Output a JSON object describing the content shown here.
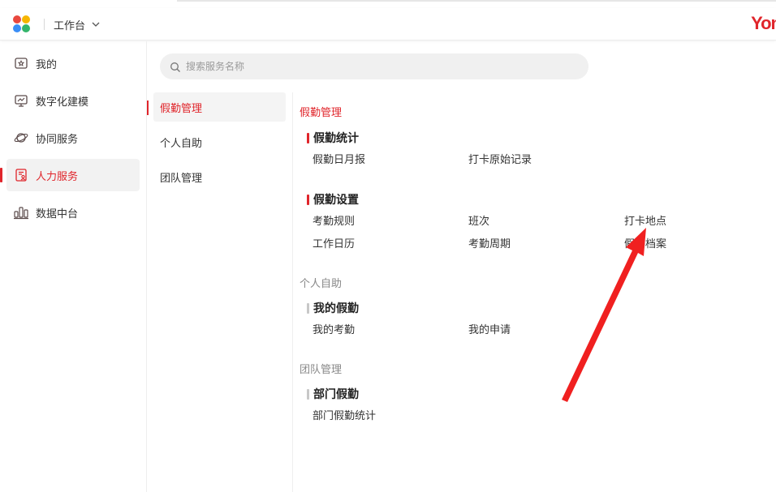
{
  "header": {
    "workbench_label": "工作台",
    "brand_text": "Yon",
    "brand_color": "#e0252b",
    "logo_colors": [
      "#e9483f",
      "#f6b500",
      "#3a8ef6",
      "#34b56b"
    ]
  },
  "search": {
    "placeholder": "搜索服务名称"
  },
  "leftnav": {
    "items": [
      {
        "label": "我的",
        "icon": "star-folder-icon",
        "active": false
      },
      {
        "label": "数字化建模",
        "icon": "monitor-chart-icon",
        "active": false
      },
      {
        "label": "协同服务",
        "icon": "planet-icon",
        "active": false
      },
      {
        "label": "人力服务",
        "icon": "id-card-icon",
        "active": true
      },
      {
        "label": "数据中台",
        "icon": "bar-chart-icon",
        "active": false
      }
    ]
  },
  "categories": [
    {
      "label": "假勤管理",
      "active": true
    },
    {
      "label": "个人自助",
      "active": false
    },
    {
      "label": "团队管理",
      "active": false
    }
  ],
  "sections": {
    "attendance": {
      "title": "假勤管理",
      "group1": {
        "title": "假勤统计",
        "links": [
          "假勤日月报",
          "打卡原始记录"
        ]
      },
      "group2": {
        "title": "假勤设置",
        "links": [
          "考勤规则",
          "班次",
          "打卡地点",
          "工作日历",
          "考勤周期",
          "假勤档案"
        ]
      }
    },
    "self": {
      "title": "个人自助",
      "group1": {
        "title": "我的假勤",
        "links": [
          "我的考勤",
          "我的申请"
        ]
      }
    },
    "team": {
      "title": "团队管理",
      "group1": {
        "title": "部门假勤",
        "links": [
          "部门假勤统计"
        ]
      }
    }
  },
  "colors": {
    "accent": "#e0252b",
    "muted_bar": "#c8c8c8"
  }
}
